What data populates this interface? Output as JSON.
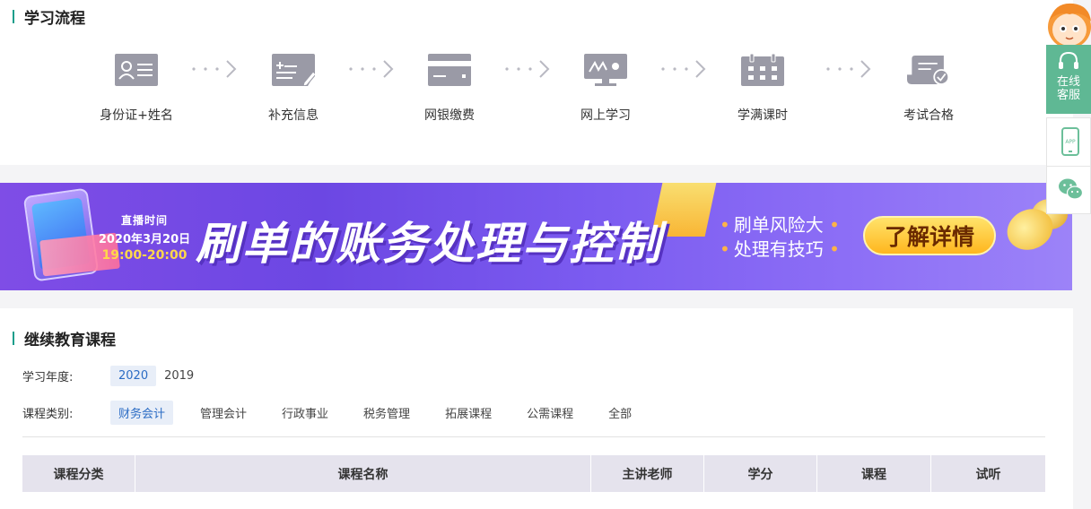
{
  "process": {
    "title": "学习流程",
    "steps": [
      {
        "label": "身份证+姓名",
        "icon": "id-card-icon"
      },
      {
        "label": "补充信息",
        "icon": "edit-form-icon"
      },
      {
        "label": "网银缴费",
        "icon": "bank-card-icon"
      },
      {
        "label": "网上学习",
        "icon": "monitor-icon"
      },
      {
        "label": "学满课时",
        "icon": "calendar-icon"
      },
      {
        "label": "考试合格",
        "icon": "exam-pass-icon"
      }
    ]
  },
  "banner": {
    "live_label": "直播时间",
    "live_date": "2020年3月20日",
    "live_hours": "19:00-20:00",
    "title": "刷单的账务处理与控制",
    "tips": [
      "刷单风险大",
      "处理有技巧"
    ],
    "cta": "了解详情"
  },
  "courses": {
    "title": "继续教育课程",
    "year_label": "学习年度:",
    "years": [
      "2020",
      "2019"
    ],
    "category_label": "课程类别:",
    "categories": [
      "财务会计",
      "管理会计",
      "行政事业",
      "税务管理",
      "拓展课程",
      "公需课程",
      "全部"
    ],
    "table_headers": [
      "课程分类",
      "课程名称",
      "主讲老师",
      "学分",
      "课程",
      "试听"
    ]
  },
  "sidebar": {
    "service_line1": "在线",
    "service_line2": "客服",
    "app_label": "APP"
  },
  "colors": {
    "accent": "#1a9e8b",
    "icon_gray": "#9a9aa6",
    "service_green": "#5fb894",
    "filter_active": "#2b6cc4"
  }
}
